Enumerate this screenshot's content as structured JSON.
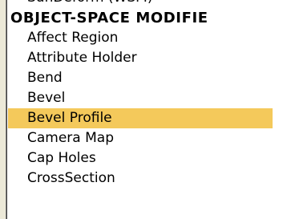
{
  "list": {
    "clipped_item": "SunDeform (WSM)",
    "section_header": "OBJECT-SPACE MODIFIE",
    "items": [
      "Affect Region",
      "Attribute Holder",
      "Bend",
      "Bevel",
      "Bevel Profile",
      "Camera Map",
      "Cap Holes",
      "CrossSection"
    ],
    "selected_item": "Bevel Profile",
    "selection_color": "#f4c95b"
  }
}
